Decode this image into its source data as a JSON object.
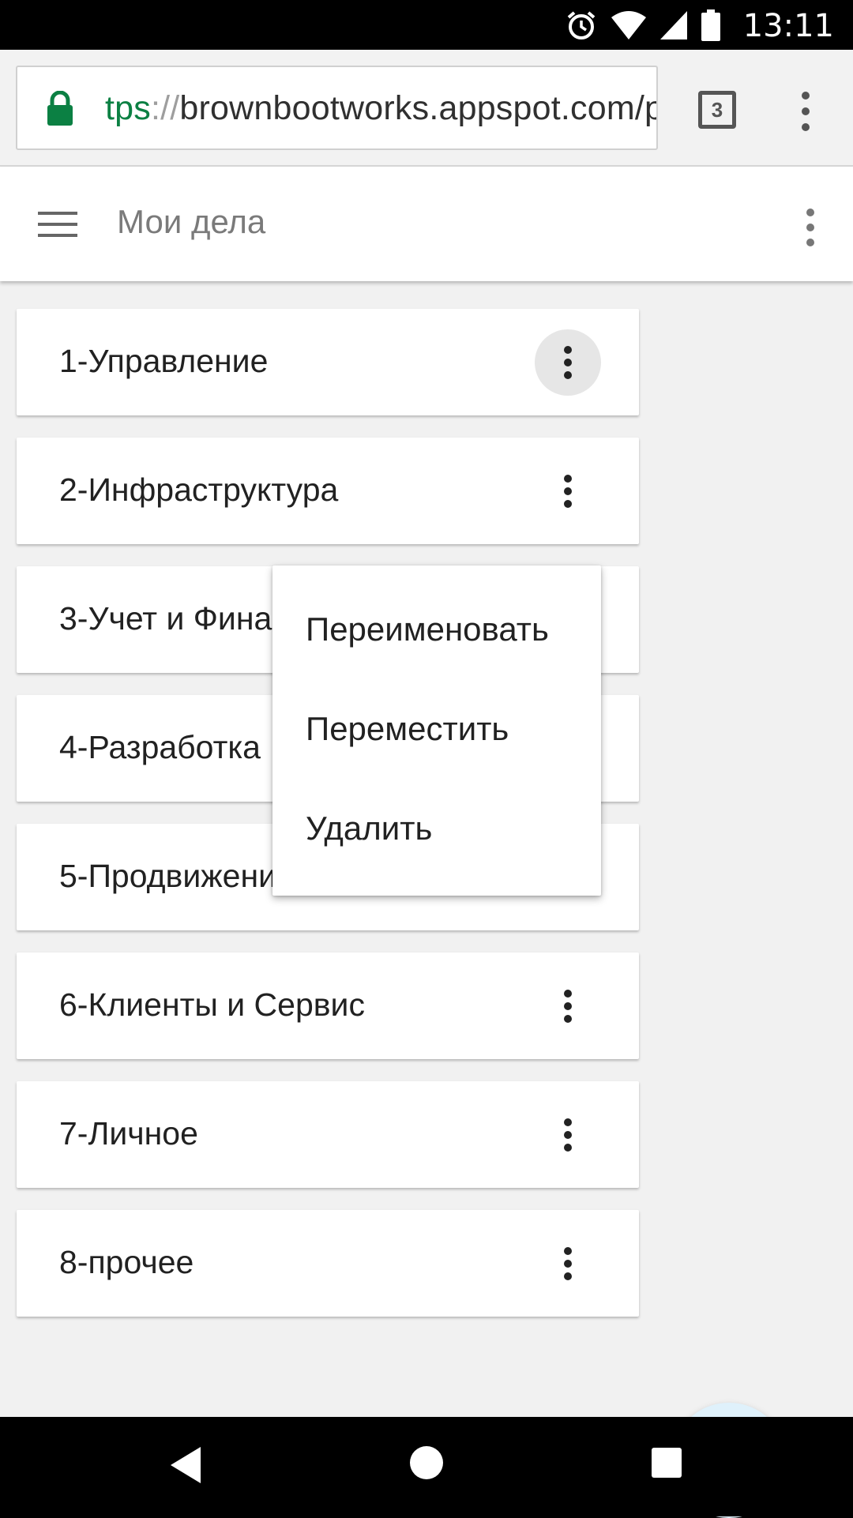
{
  "status_bar": {
    "time": "13:11",
    "icons": [
      "alarm-icon",
      "wifi-icon",
      "signal-icon",
      "battery-icon"
    ]
  },
  "browser": {
    "url_scheme": "tps",
    "url_separator": "://",
    "url_rest": "brownbootworks.appspot.com/p",
    "tab_count": "3",
    "lock_color": "#0b8043"
  },
  "app_bar": {
    "title": "Мои дела"
  },
  "items": [
    {
      "label": "1-Управление"
    },
    {
      "label": "2-Инфраструктура"
    },
    {
      "label": "3-Учет и Финансы"
    },
    {
      "label": "4-Разработка"
    },
    {
      "label": "5-Продвижение"
    },
    {
      "label": "6-Клиенты и Сервис"
    },
    {
      "label": "7-Личное"
    },
    {
      "label": "8-прочее"
    }
  ],
  "context_menu": {
    "rename": "Переименовать",
    "move": "Переместить",
    "delete": "Удалить"
  },
  "fab": {
    "icon": "plus-icon",
    "color": "#d81b60"
  },
  "nav_bar": {
    "icons": [
      "back-icon",
      "home-icon",
      "recents-icon"
    ]
  }
}
